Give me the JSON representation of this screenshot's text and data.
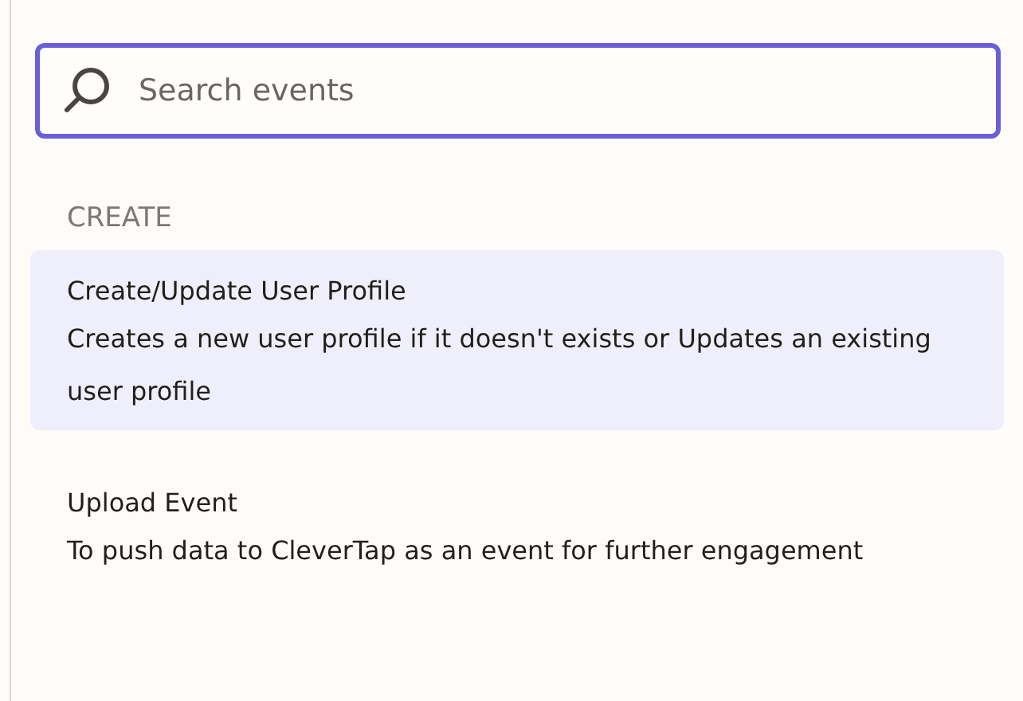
{
  "search": {
    "placeholder": "Search events"
  },
  "section": {
    "title": "CREATE"
  },
  "items": [
    {
      "title": "Create/Update User Profile",
      "description": "Creates a new user profile if it doesn't exists or Updates an existing user profile",
      "selected": true
    },
    {
      "title": "Upload Event",
      "description": "To push data to CleverTap as an event for further engagement",
      "selected": false
    }
  ]
}
